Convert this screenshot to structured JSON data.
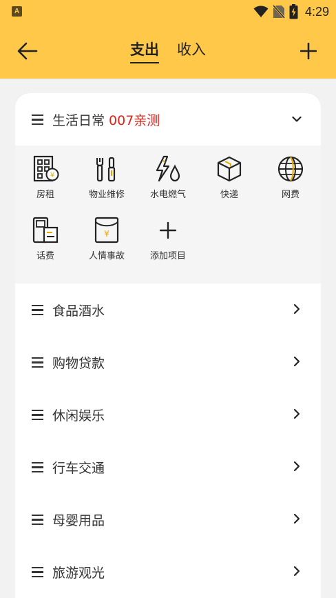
{
  "status": {
    "time": "4:29",
    "app_icon": "A"
  },
  "appbar": {
    "tabs": [
      {
        "label": "支出",
        "active": true
      },
      {
        "label": "收入",
        "active": false
      }
    ]
  },
  "group": {
    "title": "生活日常",
    "note": "007亲测",
    "note_color": "#e2231a",
    "items": [
      {
        "label": "房租",
        "icon": "building-rent-icon"
      },
      {
        "label": "物业维修",
        "icon": "tools-icon"
      },
      {
        "label": "水电燃气",
        "icon": "utilities-icon"
      },
      {
        "label": "快递",
        "icon": "package-icon"
      },
      {
        "label": "网费",
        "icon": "globe-icon"
      },
      {
        "label": "话费",
        "icon": "phone-bill-icon"
      },
      {
        "label": "人情事故",
        "icon": "red-envelope-icon"
      },
      {
        "label": "添加项目",
        "icon": "plus-icon"
      }
    ]
  },
  "categories": [
    {
      "label": "食品酒水"
    },
    {
      "label": "购物贷款"
    },
    {
      "label": "休闲娱乐"
    },
    {
      "label": "行车交通"
    },
    {
      "label": "母婴用品"
    },
    {
      "label": "旅游观光"
    }
  ],
  "colors": {
    "accent": "#ffc848",
    "background": "#f2f2f2"
  }
}
